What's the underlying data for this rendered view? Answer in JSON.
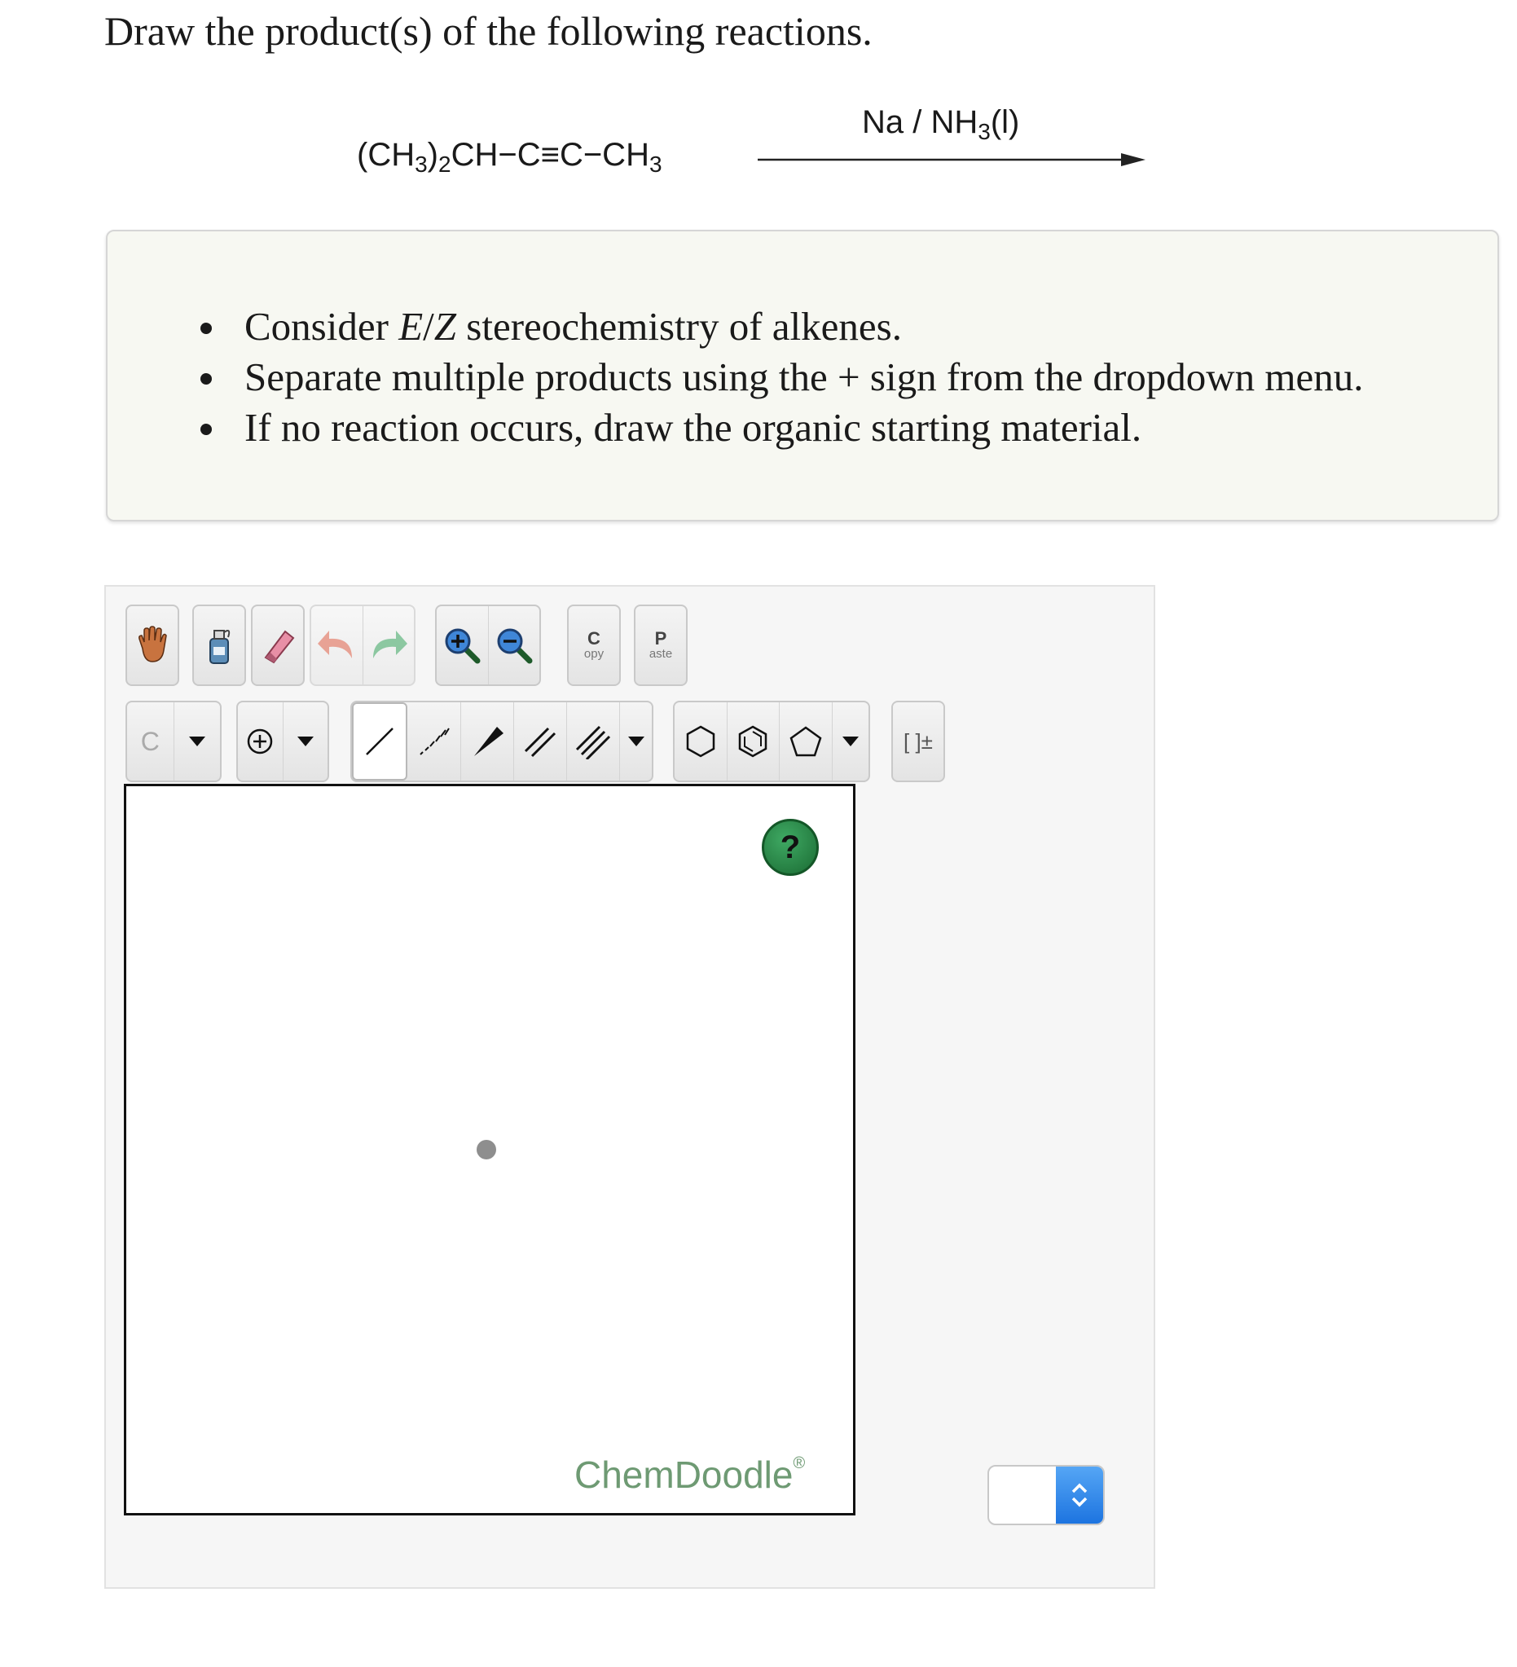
{
  "question": "Draw the product(s) of the following reactions.",
  "reaction": {
    "starting_material": {
      "p1": "(CH",
      "s1": "3",
      "p2": ")",
      "s2": "2",
      "p3": "CH−C≡C−CH",
      "s3": "3"
    },
    "reagent": {
      "p1": "Na / NH",
      "s1": "3",
      "p2": "(l)"
    }
  },
  "instructions": {
    "item1": {
      "pre": "Consider ",
      "italic": "E",
      "slash": "/",
      "italic2": "Z",
      "post": " stereochemistry of alkenes."
    },
    "item2": "Separate multiple products using the + sign from the dropdown menu.",
    "item3": "If no reaction occurs, draw the organic starting material."
  },
  "toolbar": {
    "copy_label_top": "C",
    "copy_label_bottom": "opy",
    "paste_label_top": "P",
    "paste_label_bottom": "aste",
    "atom_label": "C",
    "bracket_label": "[ ]±",
    "icons": [
      "hand-icon",
      "lasso-bottle-icon",
      "eraser-icon",
      "undo-icon",
      "redo-icon",
      "zoom-in-icon",
      "zoom-out-icon",
      "charge-plus-icon",
      "single-bond-icon",
      "dashed-bond-icon",
      "wedge-bond-icon",
      "double-bond-icon",
      "triple-bond-icon",
      "cyclohexane-icon",
      "benzene-icon",
      "cyclopentane-icon"
    ]
  },
  "canvas": {
    "help_label": "?",
    "brand": "ChemDoodle",
    "brand_mark": "®"
  },
  "dropdown": {
    "selected": ""
  },
  "colors": {
    "instructions_bg": "#f7f8f2",
    "brand_green": "#6e9a73",
    "help_green": "#1a6b33",
    "select_blue": "#1d74e0"
  }
}
